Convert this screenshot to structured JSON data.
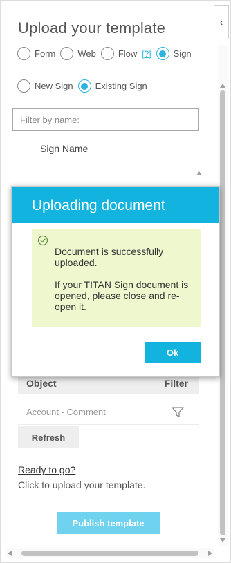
{
  "title": "Upload your template",
  "type_options": [
    {
      "label": "Form",
      "checked": false
    },
    {
      "label": "Web",
      "checked": false
    },
    {
      "label": "Flow",
      "checked": false,
      "help": "[?]"
    },
    {
      "label": "Sign",
      "checked": true
    }
  ],
  "sign_options": [
    {
      "label": "New Sign",
      "checked": false
    },
    {
      "label": "Existing Sign",
      "checked": true
    }
  ],
  "filter": {
    "placeholder": "Filter by name:",
    "value": ""
  },
  "sign_table": {
    "column": "Sign Name"
  },
  "object_table": {
    "headers": [
      "Object",
      "Filter"
    ],
    "rows": [
      {
        "object": "Account - Comment",
        "filter_icon": "funnel-icon"
      }
    ]
  },
  "refresh_label": "Refresh",
  "ready": {
    "link": "Ready to go?",
    "text": "Click to upload your template."
  },
  "publish_label": "Publish template",
  "modal": {
    "title": "Uploading document",
    "message": "Document is successfully uploaded.",
    "note": "If your TITAN Sign document is opened, please close and re-open it.",
    "ok_label": "Ok",
    "icon": "check-circle-icon"
  },
  "collapse_icon": "chevron-left-icon",
  "colors": {
    "accent": "#12b4df",
    "radio_checked": "#2ab3e0",
    "message_bg": "#eef7ce",
    "publish_disabled": "#6fd3ef"
  }
}
